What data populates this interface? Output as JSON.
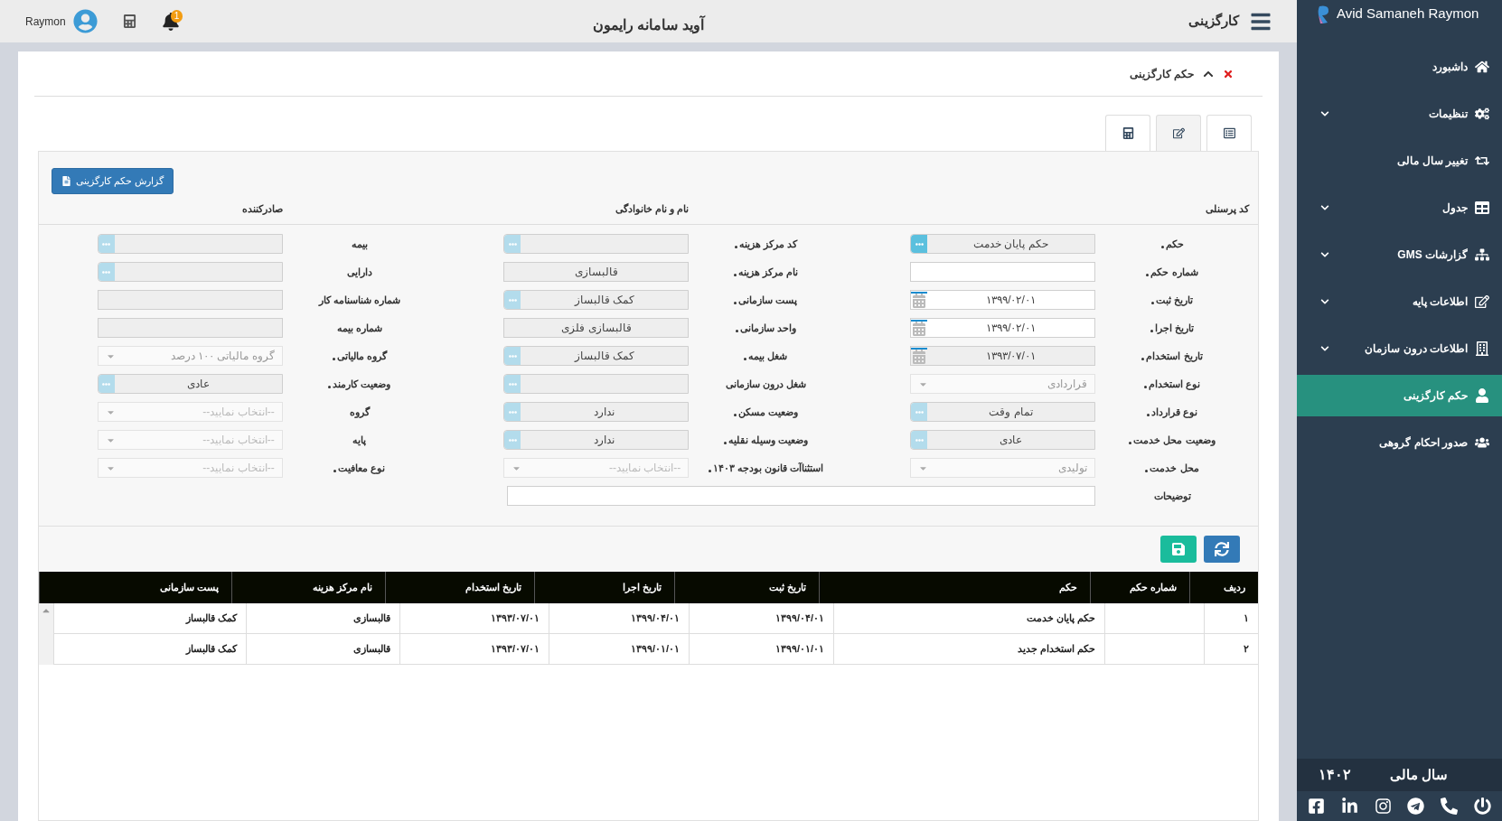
{
  "topbar": {
    "user": "Raymon",
    "notifications": "1",
    "app_title": "آوید سامانه رایمون",
    "section": "کارگزینی"
  },
  "sidebar": {
    "brand": "Avid Samaneh Raymon",
    "items": [
      {
        "label": "داشبورد",
        "expandable": false,
        "selected": false
      },
      {
        "label": "تنظیمات",
        "expandable": true,
        "selected": false
      },
      {
        "label": "تغییر سال مالی",
        "expandable": false,
        "selected": false
      },
      {
        "label": "جدول",
        "expandable": true,
        "selected": false
      },
      {
        "label": "گزارشات GMS",
        "expandable": true,
        "selected": false
      },
      {
        "label": "اطلاعات پایه",
        "expandable": true,
        "selected": false
      },
      {
        "label": "اطلاعات درون سازمان",
        "expandable": true,
        "selected": false
      },
      {
        "label": "حکم کارگزینی",
        "expandable": false,
        "selected": true
      },
      {
        "label": "صدور احکام گروهی",
        "expandable": false,
        "selected": false
      }
    ],
    "fiscal_label": "سال مالی",
    "fiscal_year": "۱۴۰۲"
  },
  "card": {
    "title": "حکم کارگزینی",
    "tabs": [
      {
        "selected": false
      },
      {
        "selected": true
      },
      {
        "selected": false
      }
    ],
    "report_button": "گزارش حکم کارگزینی",
    "header_labels": [
      "کد پرسنلی",
      "نام و نام خانوادگی",
      "صادرکننده"
    ],
    "columns": [
      [
        {
          "label": "حکم",
          "kind": "lookup",
          "value": "حکم پایان خدمت",
          "disabled": false,
          "required": true
        },
        {
          "label": "شماره حکم",
          "kind": "text",
          "required": true
        },
        {
          "label": "تاریخ ثبت",
          "kind": "date",
          "value": "۱۳۹۹/۰۲/۰۱",
          "disabled": false,
          "required": true
        },
        {
          "label": "تاریخ اجرا",
          "kind": "date",
          "value": "۱۳۹۹/۰۲/۰۱",
          "disabled": false,
          "required": true
        },
        {
          "label": "تاریخ استخدام",
          "kind": "date",
          "value": "۱۳۹۳/۰۷/۰۱",
          "disabled": true,
          "required": true
        },
        {
          "label": "نوع استخدام",
          "kind": "select",
          "value": "قراردادی",
          "required": true
        },
        {
          "label": "نوع قرارداد",
          "kind": "lookup",
          "value": "تمام وقت",
          "disabled": true,
          "required": true
        },
        {
          "label": "وضعیت محل خدمت",
          "kind": "lookup",
          "value": "عادی",
          "disabled": true,
          "required": true
        },
        {
          "label": "محل خدمت",
          "kind": "select",
          "value": "تولیدی",
          "required": true
        }
      ],
      [
        {
          "label": "کد مرکز هزینه",
          "kind": "lookup",
          "disabled": true,
          "required": true
        },
        {
          "label": "نام مرکز هزینه",
          "kind": "readonly",
          "value": "قالبسازی",
          "required": true
        },
        {
          "label": "پست سازمانی",
          "kind": "lookup",
          "value": "کمک قالبساز",
          "disabled": true,
          "required": true
        },
        {
          "label": "واحد سازمانی",
          "kind": "readonly",
          "value": "قالبسازی فلزی",
          "required": true
        },
        {
          "label": "شغل بیمه",
          "kind": "lookup",
          "value": "کمک قالبساز",
          "disabled": true,
          "required": true
        },
        {
          "label": "شغل درون سازمانی",
          "kind": "lookup",
          "disabled": true,
          "required": false
        },
        {
          "label": "وضعیت مسکن",
          "kind": "lookup",
          "value": "ندارد",
          "disabled": true,
          "required": true
        },
        {
          "label": "وضعیت وسیله نقلیه",
          "kind": "lookup",
          "value": "ندارد",
          "disabled": true,
          "required": true
        },
        {
          "label": "استثناآت قانون بودجه ۱۴۰۳",
          "kind": "select",
          "placeholder": "--انتخاب نمایید--",
          "required": true
        }
      ],
      [
        {
          "label": "بیمه",
          "kind": "lookup",
          "disabled": true,
          "required": false
        },
        {
          "label": "دارایی",
          "kind": "lookup",
          "disabled": true,
          "required": false
        },
        {
          "label": "شماره شناسنامه کار",
          "kind": "readonly",
          "required": false
        },
        {
          "label": "شماره بیمه",
          "kind": "readonly",
          "required": false
        },
        {
          "label": "گروه مالیاتی",
          "kind": "select",
          "value": "گروه مالیاتی ۱۰۰ درصد",
          "required": true
        },
        {
          "label": "وضعیت کارمند",
          "kind": "lookup",
          "value": "عادی",
          "disabled": true,
          "required": true
        },
        {
          "label": "گروه",
          "kind": "select",
          "placeholder": "--انتخاب نمایید--",
          "required": false
        },
        {
          "label": "پایه",
          "kind": "select",
          "placeholder": "--انتخاب نمایید--",
          "required": false
        },
        {
          "label": "نوع معافیت",
          "kind": "select",
          "placeholder": "--انتخاب نمایید--",
          "required": true
        }
      ]
    ],
    "notes_label": "توضیحات"
  },
  "table": {
    "columns": [
      "ردیف",
      "شماره حکم",
      "حکم",
      "تاریخ ثبت",
      "تاریخ اجرا",
      "تاریخ استخدام",
      "نام مرکز هزینه",
      "پست سازمانی"
    ],
    "rows": [
      [
        "۱",
        "",
        "حکم پایان خدمت",
        "۱۳۹۹/۰۴/۰۱",
        "۱۳۹۹/۰۴/۰۱",
        "۱۳۹۳/۰۷/۰۱",
        "قالبسازی",
        "کمک قالبساز"
      ],
      [
        "۲",
        "",
        "حکم استخدام جدید",
        "۱۳۹۹/۰۱/۰۱",
        "۱۳۹۹/۰۱/۰۱",
        "۱۳۹۳/۰۷/۰۱",
        "قالبسازی",
        "کمک قالبساز"
      ]
    ]
  }
}
